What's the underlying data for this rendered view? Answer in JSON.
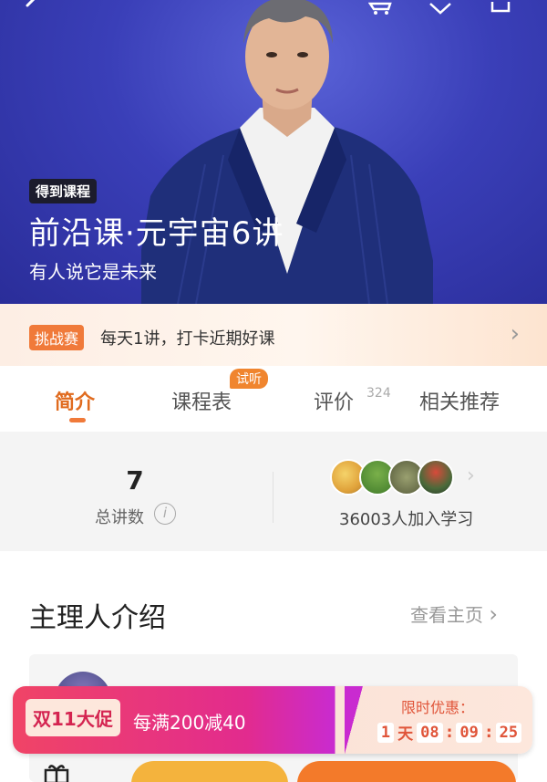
{
  "hero": {
    "brand_tag": "得到课程",
    "title": "前沿课·元宇宙6讲",
    "subtitle": "有人说它是未来"
  },
  "challenge": {
    "badge": "挑战赛",
    "text": "每天1讲，打卡近期好课",
    "arrow": "›"
  },
  "tabs": [
    {
      "label": "简介",
      "active": true
    },
    {
      "label": "课程表",
      "badge": "试听"
    },
    {
      "label": "评价",
      "count": "324"
    },
    {
      "label": "相关推荐"
    }
  ],
  "stats": {
    "lessons_count": "7",
    "lessons_label": "总讲数",
    "info_icon": "i",
    "learners": "36003人加入学习",
    "arrow": "›"
  },
  "section": {
    "title": "主理人介绍",
    "link": "查看主页",
    "link_arrow": "›"
  },
  "promo": {
    "tag": "双11大促",
    "text": "每满200减40",
    "limit_label": "限时优惠：",
    "countdown": {
      "days": "1",
      "days_unit": "天",
      "hours": "08",
      "minutes": "09",
      "seconds": "25",
      "sep": ":"
    }
  },
  "icons": {
    "back": "back-arrow-icon",
    "cart": "cart-icon",
    "favorite": "heart-icon",
    "share": "share-icon",
    "gift": "gift-icon"
  },
  "colors": {
    "hero_bg": "#3a3fb8",
    "accent_orange": "#f07a3a",
    "tab_active": "#e06b1f",
    "promo_pink": "#e22b8e",
    "btn_yellow": "#f4b33d",
    "btn_orange": "#f37a2a"
  }
}
